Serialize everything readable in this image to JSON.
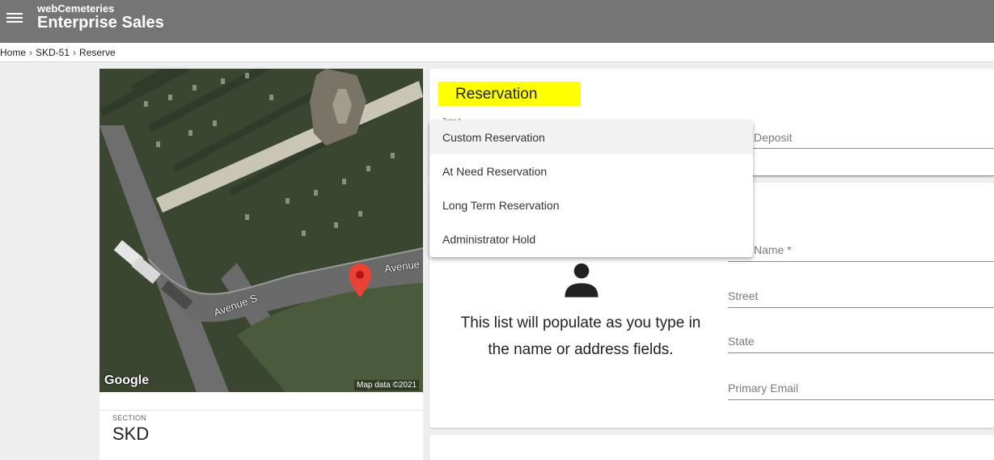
{
  "app": {
    "subtitle": "webCemeteries",
    "title": "Enterprise Sales"
  },
  "breadcrumb": [
    "Home",
    "SKD-51",
    "Reserve"
  ],
  "map": {
    "logo": "Google",
    "credit": "Map data ©2021",
    "streets": [
      "Avenue S",
      "Avenue"
    ]
  },
  "section": {
    "label": "SECTION",
    "value": "SKD"
  },
  "reservation": {
    "title": "Reservation",
    "type_label": "Type *",
    "deposit_label": "Deposit",
    "options": [
      "Custom Reservation",
      "At Need Reservation",
      "Long Term Reservation",
      "Administrator Hold"
    ],
    "highlight_color": "#ffff00"
  },
  "contact": {
    "hint": "This list will populate as you type in the name or address fields.",
    "fields": {
      "name": "Name *",
      "street": "Street",
      "state": "State",
      "email": "Primary Email"
    }
  }
}
